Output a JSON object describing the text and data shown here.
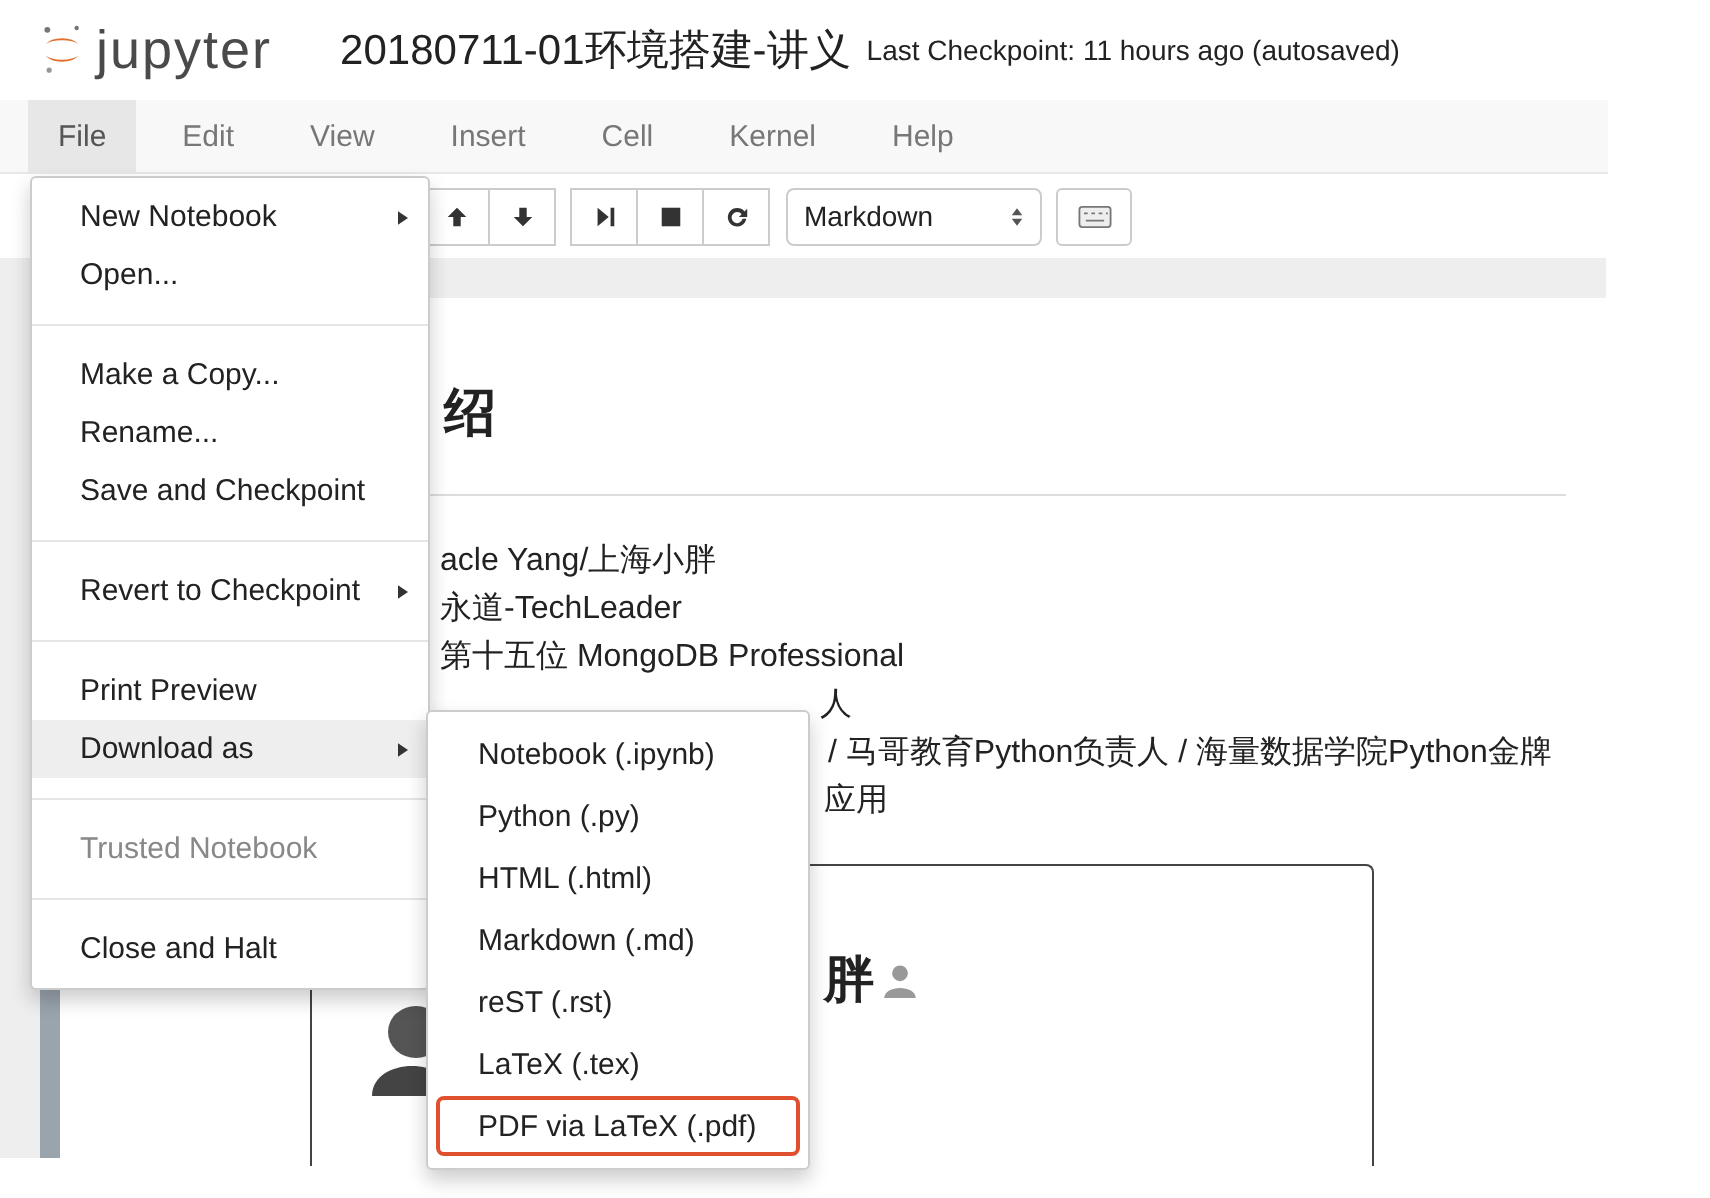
{
  "header": {
    "logo": "jupyter",
    "title": "20180711-01环境搭建-讲义",
    "checkpoint": "Last Checkpoint: 11 hours ago (autosaved)"
  },
  "menubar": [
    {
      "label": "File",
      "selected": true
    },
    {
      "label": "Edit",
      "selected": false
    },
    {
      "label": "View",
      "selected": false
    },
    {
      "label": "Insert",
      "selected": false
    },
    {
      "label": "Cell",
      "selected": false
    },
    {
      "label": "Kernel",
      "selected": false
    },
    {
      "label": "Help",
      "selected": false
    }
  ],
  "toolbar": {
    "buttons": [
      {
        "kind": "up"
      },
      {
        "kind": "down"
      },
      {
        "kind": "step"
      },
      {
        "kind": "stop"
      },
      {
        "kind": "restart"
      }
    ],
    "cell_type": "Markdown"
  },
  "notebook": {
    "heading": "绍",
    "lines": [
      "acle Yang/上海小胖",
      "永道-TechLeader",
      "第十五位 MongoDB Professional",
      "人",
      "/ 马哥教育Python负责人 / 海量数据学院Python金牌",
      "应用"
    ],
    "card_name": "胖"
  },
  "file_menu": [
    {
      "kind": "item",
      "label": "New Notebook",
      "arrow": true,
      "selected": false,
      "disabled": false
    },
    {
      "kind": "item",
      "label": "Open...",
      "arrow": false,
      "selected": false,
      "disabled": false
    },
    {
      "kind": "divider"
    },
    {
      "kind": "item",
      "label": "Make a Copy...",
      "arrow": false,
      "selected": false,
      "disabled": false
    },
    {
      "kind": "item",
      "label": "Rename...",
      "arrow": false,
      "selected": false,
      "disabled": false
    },
    {
      "kind": "item",
      "label": "Save and Checkpoint",
      "arrow": false,
      "selected": false,
      "disabled": false
    },
    {
      "kind": "divider"
    },
    {
      "kind": "item",
      "label": "Revert to Checkpoint",
      "arrow": true,
      "selected": false,
      "disabled": false
    },
    {
      "kind": "divider"
    },
    {
      "kind": "item",
      "label": "Print Preview",
      "arrow": false,
      "selected": false,
      "disabled": false
    },
    {
      "kind": "item",
      "label": "Download as",
      "arrow": true,
      "selected": true,
      "disabled": false
    },
    {
      "kind": "divider"
    },
    {
      "kind": "item",
      "label": "Trusted Notebook",
      "arrow": false,
      "selected": false,
      "disabled": true
    },
    {
      "kind": "divider"
    },
    {
      "kind": "item",
      "label": "Close and Halt",
      "arrow": false,
      "selected": false,
      "disabled": false
    }
  ],
  "download_menu": [
    {
      "label": "Notebook (.ipynb)",
      "selected": false
    },
    {
      "label": "Python (.py)",
      "selected": false
    },
    {
      "label": "HTML (.html)",
      "selected": false
    },
    {
      "label": "Markdown (.md)",
      "selected": false
    },
    {
      "label": "reST (.rst)",
      "selected": false
    },
    {
      "label": "LaTeX (.tex)",
      "selected": false
    },
    {
      "label": "PDF via LaTeX (.pdf)",
      "selected": true
    }
  ]
}
